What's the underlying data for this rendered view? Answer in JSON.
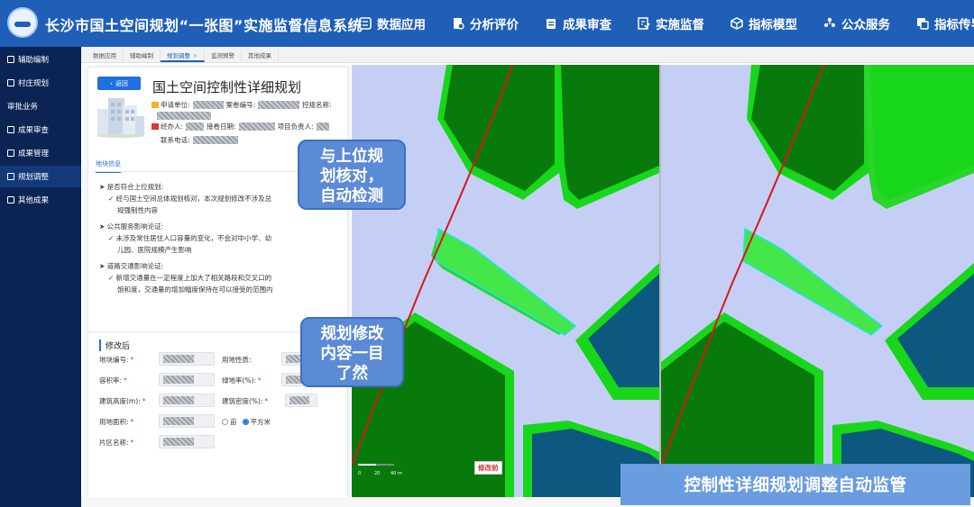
{
  "app": {
    "title": "长沙市国土空间规划“一张图”实施监督信息系统",
    "nav": [
      {
        "label": "数据应用",
        "icon": "database-icon"
      },
      {
        "label": "分析评价",
        "icon": "document-analysis-icon"
      },
      {
        "label": "成果审查",
        "icon": "folder-review-icon"
      },
      {
        "label": "实施监督",
        "icon": "monitor-icon"
      },
      {
        "label": "指标模型",
        "icon": "cube-icon"
      },
      {
        "label": "公众服务",
        "icon": "people-icon"
      },
      {
        "label": "指标传导",
        "icon": "transmit-icon"
      }
    ]
  },
  "sidebar": {
    "items": [
      {
        "label": "辅助编制",
        "icon": "sitemap-icon",
        "active": false
      },
      {
        "label": "村庄规划",
        "icon": "village-icon",
        "active": false
      },
      {
        "label": "审批业务",
        "icon": "",
        "active": false
      },
      {
        "label": "成果审查",
        "icon": "review-icon",
        "active": false
      },
      {
        "label": "成果管理",
        "icon": "manage-icon",
        "active": false
      },
      {
        "label": "规划调整",
        "icon": "adjust-icon",
        "active": true
      },
      {
        "label": "其他成果",
        "icon": "other-icon",
        "active": false
      }
    ]
  },
  "tabs": [
    {
      "label": "数据应用",
      "active": false
    },
    {
      "label": "辅助编制",
      "active": false
    },
    {
      "label": "规划调整",
      "active": true,
      "close": "×"
    },
    {
      "label": "监测预警",
      "active": false
    },
    {
      "label": "其他成果",
      "active": false
    }
  ],
  "detail": {
    "back_label": "返回",
    "title": "国土空间控制性详细规划",
    "meta": {
      "applicant_label": "申请单位:",
      "case_no_label": "案卷编号:",
      "plan_name_label": "控规名称:",
      "handler_label": "经办人:",
      "received_label": "接卷日期:",
      "manager_label": "项目负责人:",
      "phone_label": "联系电话:"
    },
    "section_tab": "地块信息",
    "checks": [
      {
        "q": "➤ 是否符合上位规划:",
        "a": [
          "✓ 经与国土空间总体规划核对，本次规划修改不涉及总",
          "规强制性内容"
        ]
      },
      {
        "q": "➤ 公共服务影响论证:",
        "a": [
          "✓ 未涉及常住居住人口容量的变化，不会对中小学、幼",
          "儿园、医院规模产生影响"
        ]
      },
      {
        "q": "➤ 道路交通影响论证:",
        "a": [
          "✓ 新增交通量在一定程度上加大了相关路段和交叉口的",
          "饱和度，交通量的增加幅度保持在可以接受的范围内"
        ]
      }
    ]
  },
  "modified": {
    "title": "修改后",
    "fields": {
      "parcel_no": "地块编号:",
      "land_use": "用地性质:",
      "far": "容积率:",
      "green_ratio": "绿地率(%):",
      "bldg_height": "建筑高度(m):",
      "bldg_density": "建筑密度(%):",
      "land_area": "用地面积:",
      "zone_name": "片区名称:"
    },
    "unit_options": [
      "亩",
      "平方米"
    ],
    "unit_selected": "平方米"
  },
  "callouts": {
    "top": [
      "与上位规",
      "划核对，",
      "自动检测"
    ],
    "bottom": [
      "规划修改",
      "内容一目",
      "了然"
    ]
  },
  "map": {
    "before_label": "修改前",
    "scale": {
      "t0": "0",
      "t1": "20",
      "t2": "40 m"
    },
    "colors": {
      "road": "#c5cff5",
      "dark_green": "#087a0b",
      "bright_green": "#18d61a",
      "light_green": "#2ad62a",
      "teal": "#0c587f",
      "highlight": "#22e2ea",
      "boundary": "#d8161c"
    }
  },
  "banner": "控制性详细规划调整自动监管"
}
